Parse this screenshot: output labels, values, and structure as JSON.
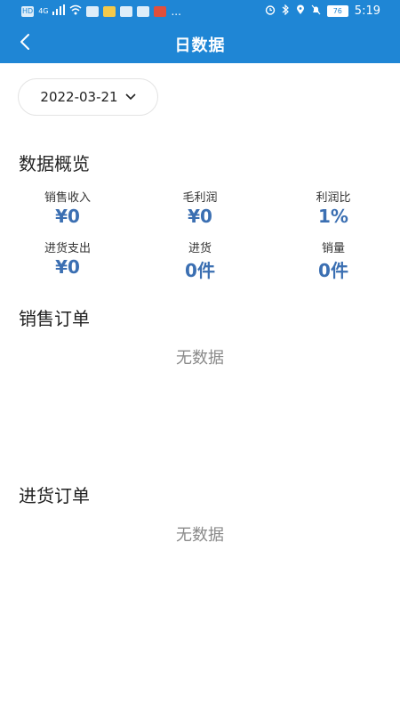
{
  "status_bar": {
    "left_icons": [
      "HD",
      "4G",
      "signal",
      "wifi",
      "app1",
      "app2",
      "app3",
      "app4",
      "app5",
      "..."
    ],
    "battery": "76",
    "time": "5:19"
  },
  "header": {
    "title": "日数据"
  },
  "date_selector": {
    "value": "2022-03-21"
  },
  "overview": {
    "title": "数据概览",
    "stats": [
      {
        "label": "销售收入",
        "value": "¥0"
      },
      {
        "label": "毛利润",
        "value": "¥0"
      },
      {
        "label": "利润比",
        "value": "1%"
      },
      {
        "label": "进货支出",
        "value": "¥0"
      },
      {
        "label": "进货",
        "value": "0件"
      },
      {
        "label": "销量",
        "value": "0件"
      }
    ]
  },
  "sales_orders": {
    "title": "销售订单",
    "empty_text": "无数据"
  },
  "purchase_orders": {
    "title": "进货订单",
    "empty_text": "无数据"
  },
  "colors": {
    "primary": "#1f86d5",
    "value_blue": "#3b6fb2"
  }
}
